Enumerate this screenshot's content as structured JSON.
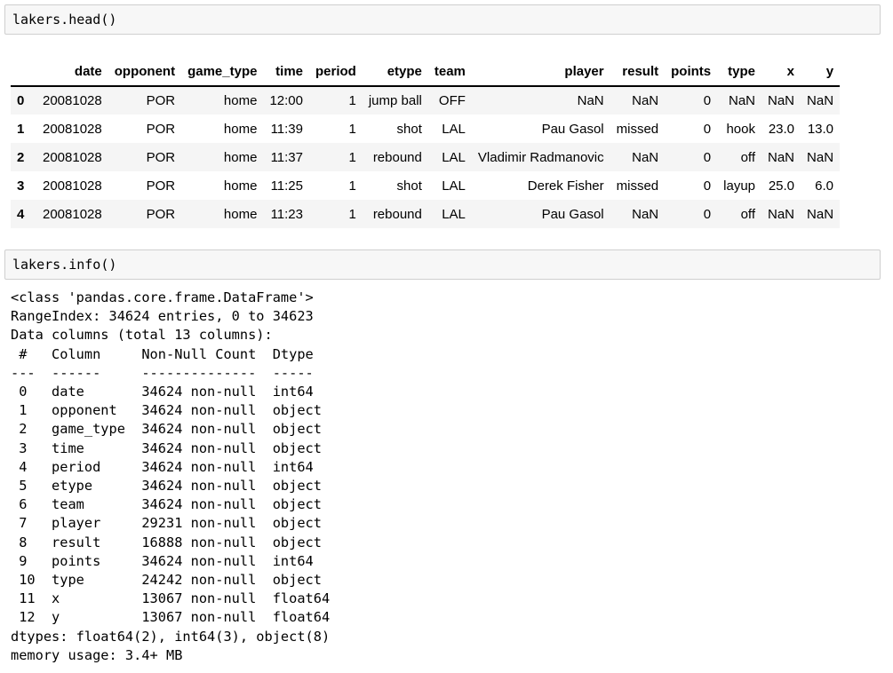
{
  "cells": [
    {
      "input": "lakers.head()"
    },
    {
      "input": "lakers.info()"
    }
  ],
  "dataframe": {
    "columns": [
      "",
      "date",
      "opponent",
      "game_type",
      "time",
      "period",
      "etype",
      "team",
      "player",
      "result",
      "points",
      "type",
      "x",
      "y"
    ],
    "rows": [
      [
        "0",
        "20081028",
        "POR",
        "home",
        "12:00",
        "1",
        "jump ball",
        "OFF",
        "NaN",
        "NaN",
        "0",
        "NaN",
        "NaN",
        "NaN"
      ],
      [
        "1",
        "20081028",
        "POR",
        "home",
        "11:39",
        "1",
        "shot",
        "LAL",
        "Pau Gasol",
        "missed",
        "0",
        "hook",
        "23.0",
        "13.0"
      ],
      [
        "2",
        "20081028",
        "POR",
        "home",
        "11:37",
        "1",
        "rebound",
        "LAL",
        "Vladimir Radmanovic",
        "NaN",
        "0",
        "off",
        "NaN",
        "NaN"
      ],
      [
        "3",
        "20081028",
        "POR",
        "home",
        "11:25",
        "1",
        "shot",
        "LAL",
        "Derek Fisher",
        "missed",
        "0",
        "layup",
        "25.0",
        "6.0"
      ],
      [
        "4",
        "20081028",
        "POR",
        "home",
        "11:23",
        "1",
        "rebound",
        "LAL",
        "Pau Gasol",
        "NaN",
        "0",
        "off",
        "NaN",
        "NaN"
      ]
    ]
  },
  "info_output": [
    "<class 'pandas.core.frame.DataFrame'>",
    "RangeIndex: 34624 entries, 0 to 34623",
    "Data columns (total 13 columns):",
    " #   Column     Non-Null Count  Dtype  ",
    "---  ------     --------------  -----  ",
    " 0   date       34624 non-null  int64  ",
    " 1   opponent   34624 non-null  object ",
    " 2   game_type  34624 non-null  object ",
    " 3   time       34624 non-null  object ",
    " 4   period     34624 non-null  int64  ",
    " 5   etype      34624 non-null  object ",
    " 6   team       34624 non-null  object ",
    " 7   player     29231 non-null  object ",
    " 8   result     16888 non-null  object ",
    " 9   points     34624 non-null  int64  ",
    " 10  type       24242 non-null  object ",
    " 11  x          13067 non-null  float64",
    " 12  y          13067 non-null  float64",
    "dtypes: float64(2), int64(3), object(8)",
    "memory usage: 3.4+ MB"
  ]
}
